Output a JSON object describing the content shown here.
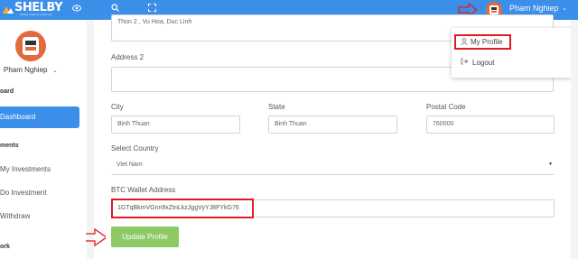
{
  "brand": {
    "name": "SHELBY",
    "tagline": "Shelby Trade & Investment"
  },
  "topbar": {
    "user_name": "Pham Nghiep",
    "caret": "⌄"
  },
  "user_menu": {
    "items": [
      "My Profile",
      "Logout"
    ]
  },
  "sidebar": {
    "user_name": "Pham Nghiep",
    "sections": [
      "oard",
      "ments",
      "ork"
    ],
    "active_label": "Dashboard",
    "items": [
      "My Investments",
      "Do Investment",
      "Withdraw"
    ]
  },
  "form": {
    "address1_value": "Thon 2 , Vu Hoa, Duc Linh",
    "address2_label": "Address 2",
    "address2_value": "",
    "city_label": "City",
    "city_value": "Binh Thuan",
    "state_label": "State",
    "state_value": "Binh Thuan",
    "postal_label": "Postal Code",
    "postal_value": "760000",
    "country_label": "Select Country",
    "country_value": "Viet Nam",
    "btc_label": "BTC Wallet Address",
    "btc_value": "1GTqBkmVGnn9xZtnLkzJggVyYJ8FYkG76",
    "submit_label": "Update Profile"
  },
  "colors": {
    "primary": "#3b8fe8",
    "success": "#8dc965",
    "highlight": "#e01b24",
    "avatar": "#e36a3e"
  }
}
